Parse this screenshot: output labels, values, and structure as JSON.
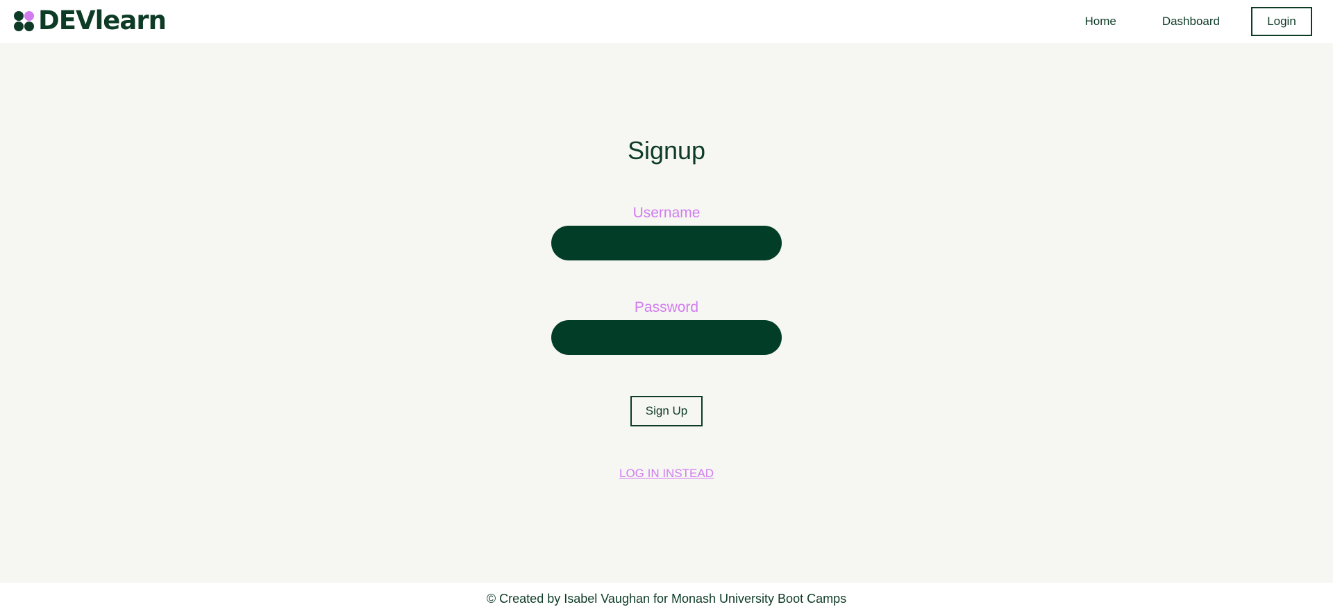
{
  "colors": {
    "brand_dark": "#0d3b26",
    "accent": "#d27cf0",
    "input_bg": "#023d27",
    "background": "#f6f6f2",
    "header_bg": "#ffffff"
  },
  "header": {
    "logo": {
      "text": "DEVlearn",
      "icon": "four-dots-logo-icon"
    },
    "nav": {
      "home": "Home",
      "dashboard": "Dashboard",
      "login": "Login"
    }
  },
  "form": {
    "title": "Signup",
    "username_label": "Username",
    "username_value": "",
    "password_label": "Password",
    "password_value": "",
    "submit_label": "Sign Up",
    "alt_link": "LOG IN INSTEAD"
  },
  "footer": {
    "text": "© Created by Isabel Vaughan for Monash University Boot Camps"
  }
}
